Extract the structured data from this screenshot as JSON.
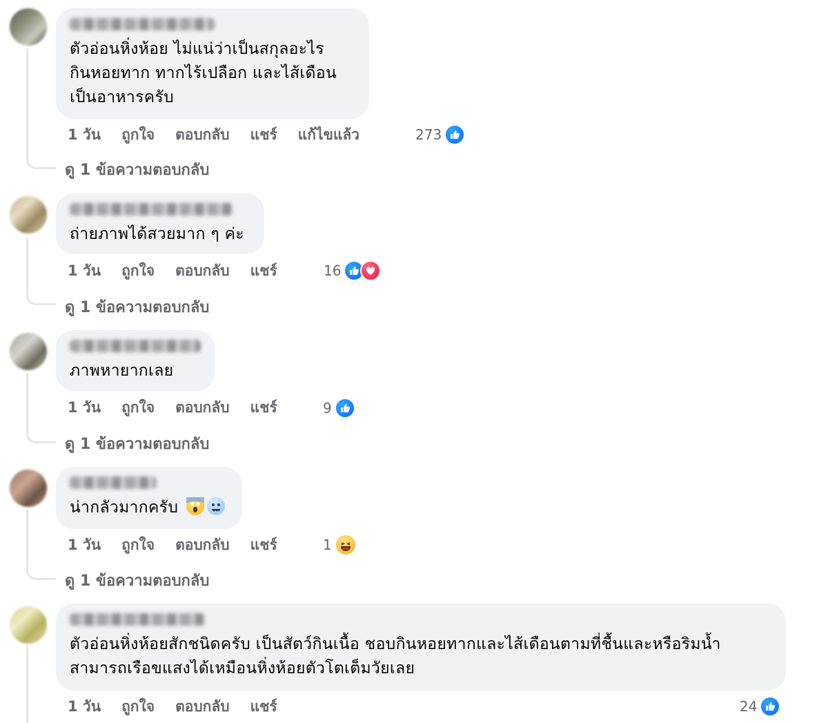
{
  "colors": {
    "bubble": "#f0f2f5",
    "secondary_text": "#65676b",
    "like_blue": "#0866ff",
    "love_red": "#e41e3f",
    "thread_line": "#e4e6eb"
  },
  "comments": [
    {
      "text": "ตัวอ่อนหิ่งห้อย ไม่แน่ว่าเป็นสกุลอะไร\nกินหอยทาก ทากไร้เปลือก และไส้เดือน\nเป็นอาหารครับ",
      "time": "1 วัน",
      "like": "ถูกใจ",
      "reply": "ตอบกลับ",
      "share": "แชร์",
      "edited": "แก้ไขแล้ว",
      "reaction_count": "273",
      "reactions": [
        "like-icon"
      ],
      "view_replies": "ดู 1 ข้อความตอบกลับ"
    },
    {
      "text": "ถ่ายภาพได้สวยมาก ๆ ค่ะ",
      "time": "1 วัน",
      "like": "ถูกใจ",
      "reply": "ตอบกลับ",
      "share": "แชร์",
      "reaction_count": "16",
      "reactions": [
        "like-icon",
        "love-icon"
      ],
      "view_replies": "ดู 1 ข้อความตอบกลับ"
    },
    {
      "text": "ภาพหายากเลย",
      "time": "1 วัน",
      "like": "ถูกใจ",
      "reply": "ตอบกลับ",
      "share": "แชร์",
      "reaction_count": "9",
      "reactions": [
        "like-icon"
      ],
      "view_replies": "ดู 1 ข้อความตอบกลับ"
    },
    {
      "text": "น่ากลัวมากครับ",
      "emojis": [
        "scream-emoji-icon",
        "cold-sweat-emoji-icon"
      ],
      "time": "1 วัน",
      "like": "ถูกใจ",
      "reply": "ตอบกลับ",
      "share": "แชร์",
      "reaction_count": "1",
      "reactions": [
        "haha-icon"
      ],
      "view_replies": "ดู 1 ข้อความตอบกลับ"
    },
    {
      "text": "ตัวอ่อนหิ่งห้อยสักชนิดครับ เป็นสัตว์กินเนื้อ ชอบกินหอยทากและไส้เดือนตามที่ชื้นและหรือริมน้ำ\nสามารถเรือขแสงได้เหมือนหิ่งห้อยตัวโตเต็มวัยเลย",
      "time": "1 วัน",
      "like": "ถูกใจ",
      "reply": "ตอบกลับ",
      "share": "แชร์",
      "reaction_count": "24",
      "reactions": [
        "like-icon"
      ]
    }
  ]
}
